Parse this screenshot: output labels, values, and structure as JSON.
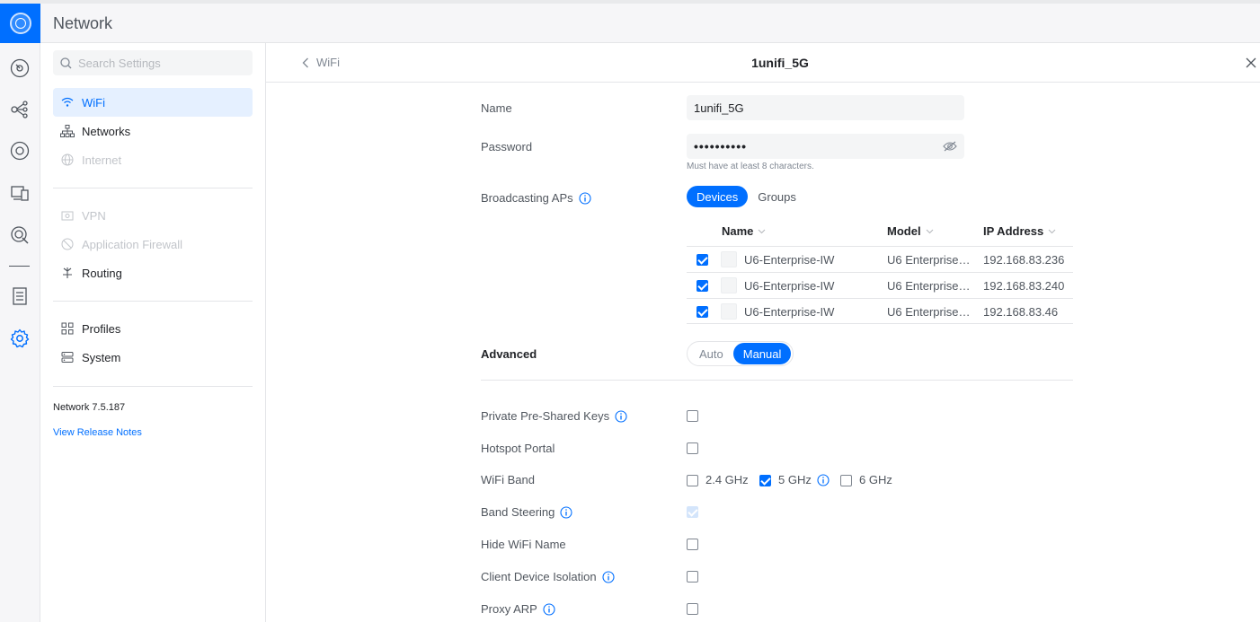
{
  "app": {
    "title": "Network"
  },
  "rail": [
    {
      "name": "dashboard-icon"
    },
    {
      "name": "topology-icon"
    },
    {
      "name": "devices-icon"
    },
    {
      "name": "clients-icon"
    },
    {
      "name": "insights-icon"
    },
    {
      "name": "logs-icon"
    },
    {
      "name": "settings-icon",
      "active": true
    }
  ],
  "sidebar": {
    "search_placeholder": "Search Settings",
    "items": [
      {
        "label": "WiFi",
        "icon": "wifi-icon",
        "state": "active"
      },
      {
        "label": "Networks",
        "icon": "network-tree-icon",
        "state": "normal"
      },
      {
        "label": "Internet",
        "icon": "globe-icon",
        "state": "disabled"
      },
      {
        "label": "VPN",
        "icon": "vpn-icon",
        "state": "disabled"
      },
      {
        "label": "Application Firewall",
        "icon": "firewall-icon",
        "state": "disabled"
      },
      {
        "label": "Routing",
        "icon": "routing-icon",
        "state": "normal"
      },
      {
        "label": "Profiles",
        "icon": "profiles-icon",
        "state": "normal"
      },
      {
        "label": "System",
        "icon": "system-icon",
        "state": "normal"
      }
    ],
    "version": "Network 7.5.187",
    "release_notes": "View Release Notes"
  },
  "panel": {
    "back_label": "WiFi",
    "title": "1unifi_5G",
    "name_label": "Name",
    "name_value": "1unifi_5G",
    "password_label": "Password",
    "password_value": "••••••••••",
    "password_hint": "Must have at least 8 characters.",
    "broadcasting_label": "Broadcasting APs",
    "ap_toggle": {
      "options": [
        "Devices",
        "Groups"
      ],
      "selected": "Devices"
    },
    "ap_table": {
      "columns": [
        "Name",
        "Model",
        "IP Address"
      ],
      "rows": [
        {
          "checked": true,
          "name": "U6-Enterprise-IW",
          "model": "U6 Enterprise…",
          "ip": "192.168.83.236"
        },
        {
          "checked": true,
          "name": "U6-Enterprise-IW",
          "model": "U6 Enterprise…",
          "ip": "192.168.83.240"
        },
        {
          "checked": true,
          "name": "U6-Enterprise-IW",
          "model": "U6 Enterprise…",
          "ip": "192.168.83.46"
        }
      ]
    },
    "advanced_label": "Advanced",
    "advanced_toggle": {
      "options": [
        "Auto",
        "Manual"
      ],
      "selected": "Manual"
    },
    "options": {
      "ppsk": "Private Pre-Shared Keys",
      "hotspot": "Hotspot Portal",
      "band": "WiFi Band",
      "band_steering": "Band Steering",
      "hide_name": "Hide WiFi Name",
      "isolation": "Client Device Isolation",
      "proxy_arp": "Proxy ARP"
    },
    "bands": [
      {
        "label": "2.4 GHz",
        "checked": false
      },
      {
        "label": "5 GHz",
        "checked": true
      },
      {
        "label": "6 GHz",
        "checked": false
      }
    ]
  },
  "colors": {
    "accent": "#006fff",
    "active_bg": "#e5f0ff",
    "muted": "#50565e"
  }
}
